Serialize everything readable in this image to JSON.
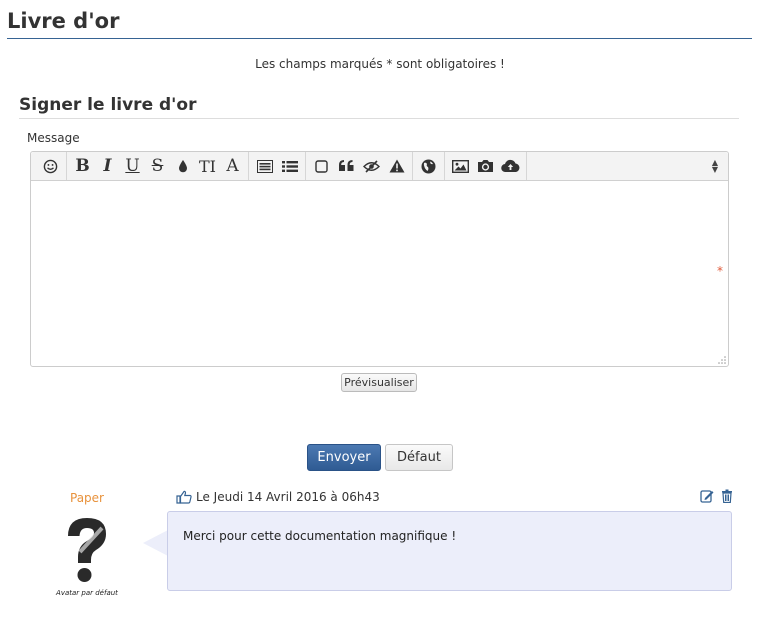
{
  "page": {
    "title": "Livre d'or",
    "required_note": "Les champs marqués * sont obligatoires !"
  },
  "form": {
    "section_title": "Signer le livre d'or",
    "message_label": "Message",
    "message_value": "",
    "required_marker": "*",
    "preview_label": "Prévisualiser",
    "send_label": "Envoyer",
    "default_label": "Défaut"
  },
  "toolbar": {
    "groups": [
      [
        "smiley-icon"
      ],
      [
        "bold-icon",
        "italic-icon",
        "underline-icon",
        "strikethrough-icon",
        "color-drop-icon",
        "font-size-icon",
        "font-family-icon"
      ],
      [
        "list-box-icon",
        "bullet-list-icon"
      ],
      [
        "square-icon",
        "quote-icon",
        "hide-eye-icon",
        "warning-icon"
      ],
      [
        "globe-icon"
      ],
      [
        "image-icon",
        "camera-icon",
        "upload-cloud-icon"
      ]
    ],
    "glyphs": {
      "bold": "B",
      "italic": "I",
      "underline": "U",
      "strike": "S",
      "fontsize": "TI",
      "font": "A"
    }
  },
  "entries": [
    {
      "author": "Paper",
      "avatar_caption": "Avatar par défaut",
      "date": "Le Jeudi 14 Avril 2016 à 06h43",
      "message": "Merci pour cette documentation magnifique !"
    }
  ],
  "colors": {
    "accent": "#366393",
    "author": "#e8923c",
    "bubble": "#eceefa",
    "required": "#e05a3a"
  }
}
